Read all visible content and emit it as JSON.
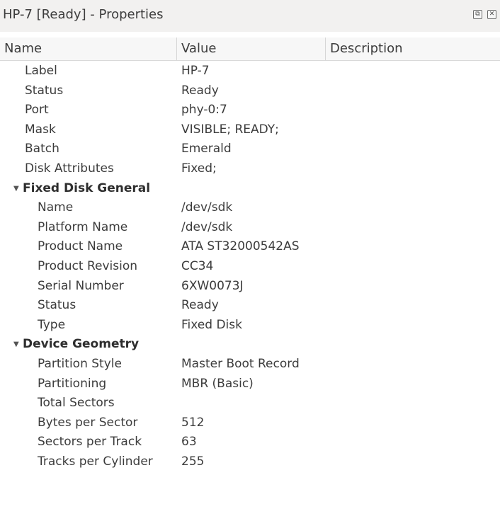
{
  "window": {
    "title": "HP-7 [Ready] - Properties",
    "float_icon": "float-icon",
    "close_icon": "close-icon"
  },
  "columns": {
    "name": "Name",
    "value": "Value",
    "description": "Description"
  },
  "rows": [
    {
      "kind": "item",
      "level": 0,
      "name": "Label",
      "value": "HP-7"
    },
    {
      "kind": "item",
      "level": 0,
      "name": "Status",
      "value": "Ready"
    },
    {
      "kind": "item",
      "level": 0,
      "name": "Port",
      "value": "phy-0:7"
    },
    {
      "kind": "item",
      "level": 0,
      "name": "Mask",
      "value": "VISIBLE; READY;"
    },
    {
      "kind": "item",
      "level": 0,
      "name": "Batch",
      "value": "Emerald"
    },
    {
      "kind": "item",
      "level": 0,
      "name": "Disk Attributes",
      "value": "Fixed;"
    },
    {
      "kind": "group",
      "name": "Fixed Disk General",
      "expanded": true
    },
    {
      "kind": "item",
      "level": 1,
      "name": "Name",
      "value": "/dev/sdk"
    },
    {
      "kind": "item",
      "level": 1,
      "name": "Platform Name",
      "value": "/dev/sdk"
    },
    {
      "kind": "item",
      "level": 1,
      "name": "Product Name",
      "value": "ATA ST32000542AS"
    },
    {
      "kind": "item",
      "level": 1,
      "name": "Product Revision",
      "value": "CC34"
    },
    {
      "kind": "item",
      "level": 1,
      "name": "Serial Number",
      "value": "6XW0073J"
    },
    {
      "kind": "item",
      "level": 1,
      "name": "Status",
      "value": "Ready"
    },
    {
      "kind": "item",
      "level": 1,
      "name": "Type",
      "value": "Fixed Disk"
    },
    {
      "kind": "group",
      "name": "Device Geometry",
      "expanded": true
    },
    {
      "kind": "item",
      "level": 1,
      "name": "Partition Style",
      "value": "Master Boot Record"
    },
    {
      "kind": "item",
      "level": 1,
      "name": "Partitioning",
      "value": "MBR (Basic)"
    },
    {
      "kind": "item",
      "level": 1,
      "name": "Total Sectors",
      "value": ""
    },
    {
      "kind": "item",
      "level": 1,
      "name": "Bytes per Sector",
      "value": "512"
    },
    {
      "kind": "item",
      "level": 1,
      "name": "Sectors per Track",
      "value": "63"
    },
    {
      "kind": "item",
      "level": 1,
      "name": "Tracks per Cylinder",
      "value": "255"
    }
  ]
}
